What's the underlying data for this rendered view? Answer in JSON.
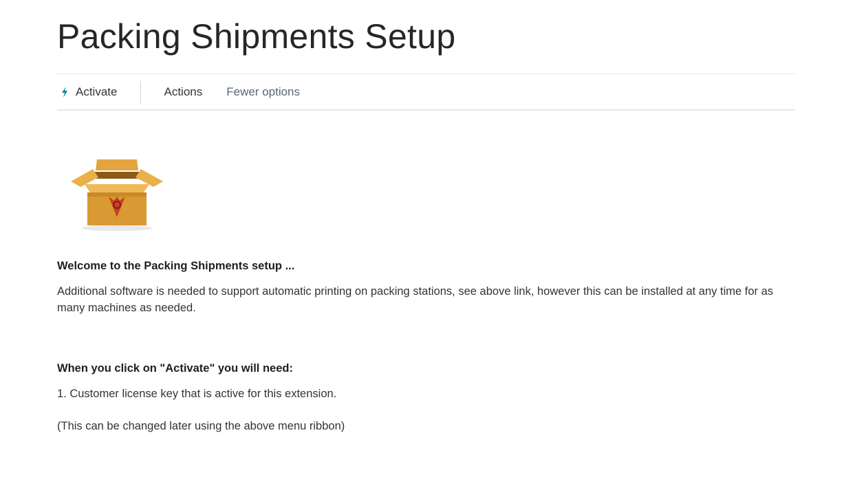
{
  "page": {
    "title": "Packing Shipments Setup"
  },
  "ribbon": {
    "activate_label": "Activate",
    "activate_icon": "lightning-icon",
    "activate_icon_color": "#00859a",
    "actions_label": "Actions",
    "fewer_options_label": "Fewer options"
  },
  "content": {
    "image_icon": "open-package-icon",
    "welcome_heading": "Welcome to the Packing Shipments setup ...",
    "welcome_text": "Additional software is needed to support automatic printing on packing stations, see above link, however this can be installed at any time for as many machines as needed.",
    "activate_heading": "When you click on \"Activate\" you will need:",
    "requirement_1": "1. Customer license key that is active for this extension.",
    "note": "(This can be changed later using the above menu ribbon)"
  }
}
